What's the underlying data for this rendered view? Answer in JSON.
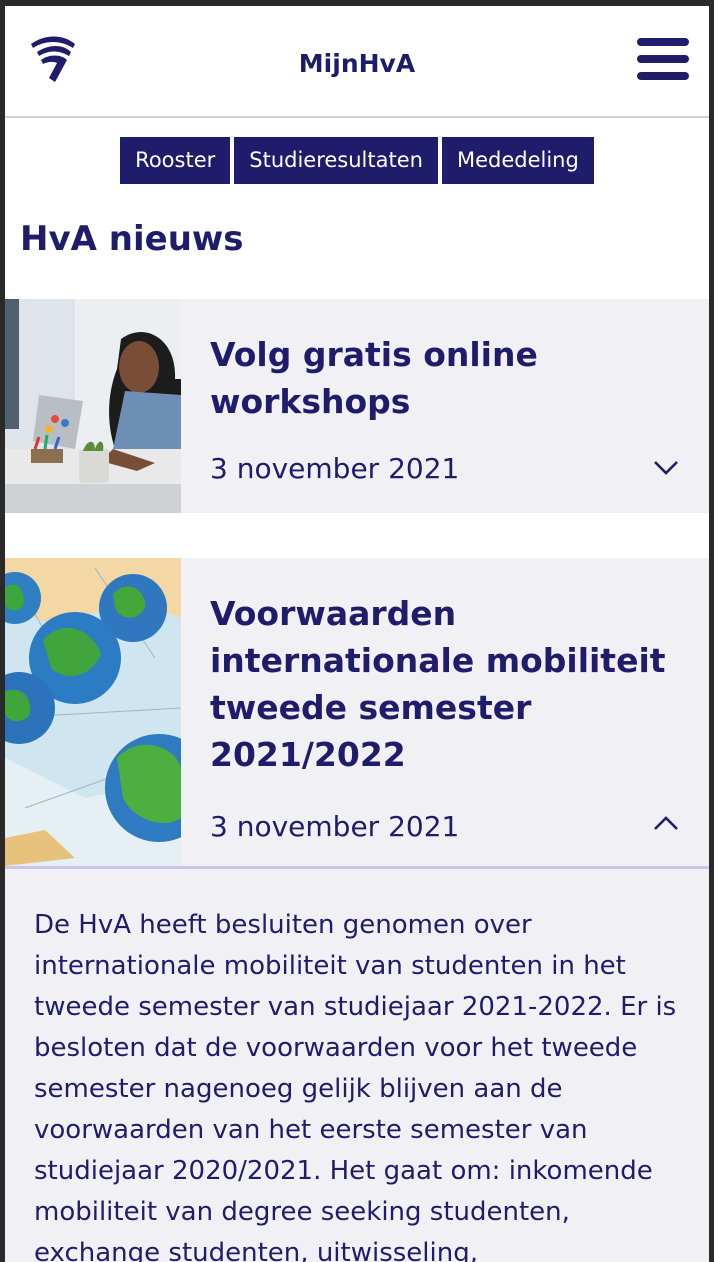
{
  "header": {
    "title": "MijnHvA",
    "logo": "hva-logo",
    "menu_icon": "hamburger-icon"
  },
  "tabs": [
    {
      "label": "Rooster"
    },
    {
      "label": "Studieresultaten"
    },
    {
      "label": "Mededeling"
    }
  ],
  "section": {
    "title": "HvA nieuws"
  },
  "news": [
    {
      "title": "Volg gratis online workshops",
      "date": "3 november 2021",
      "expanded": false,
      "toggle_icon": "chevron-down-icon",
      "image": "woman-at-laptop-photo"
    },
    {
      "title": "Voorwaarden internationale mobiliteit tweede semester 2021/2022",
      "date": "3 november 2021",
      "expanded": true,
      "toggle_icon": "chevron-up-icon",
      "image": "globes-on-map-photo",
      "body": "De HvA heeft besluiten genomen over internationale mobiliteit van studenten in het tweede semester van studiejaar 2021-2022. Er is besloten dat de voorwaarden voor het tweede semester nagenoeg gelijk blijven aan de voorwaarden van het eerste semester van studiejaar 2020/2021. Het gaat om: inkomende mobiliteit van degree seeking studenten, exchange studenten, uitwisseling,"
    }
  ],
  "colors": {
    "brand": "#1f1d6b",
    "card_bg": "#f1f0f5",
    "divider": "#c9c6ec"
  }
}
